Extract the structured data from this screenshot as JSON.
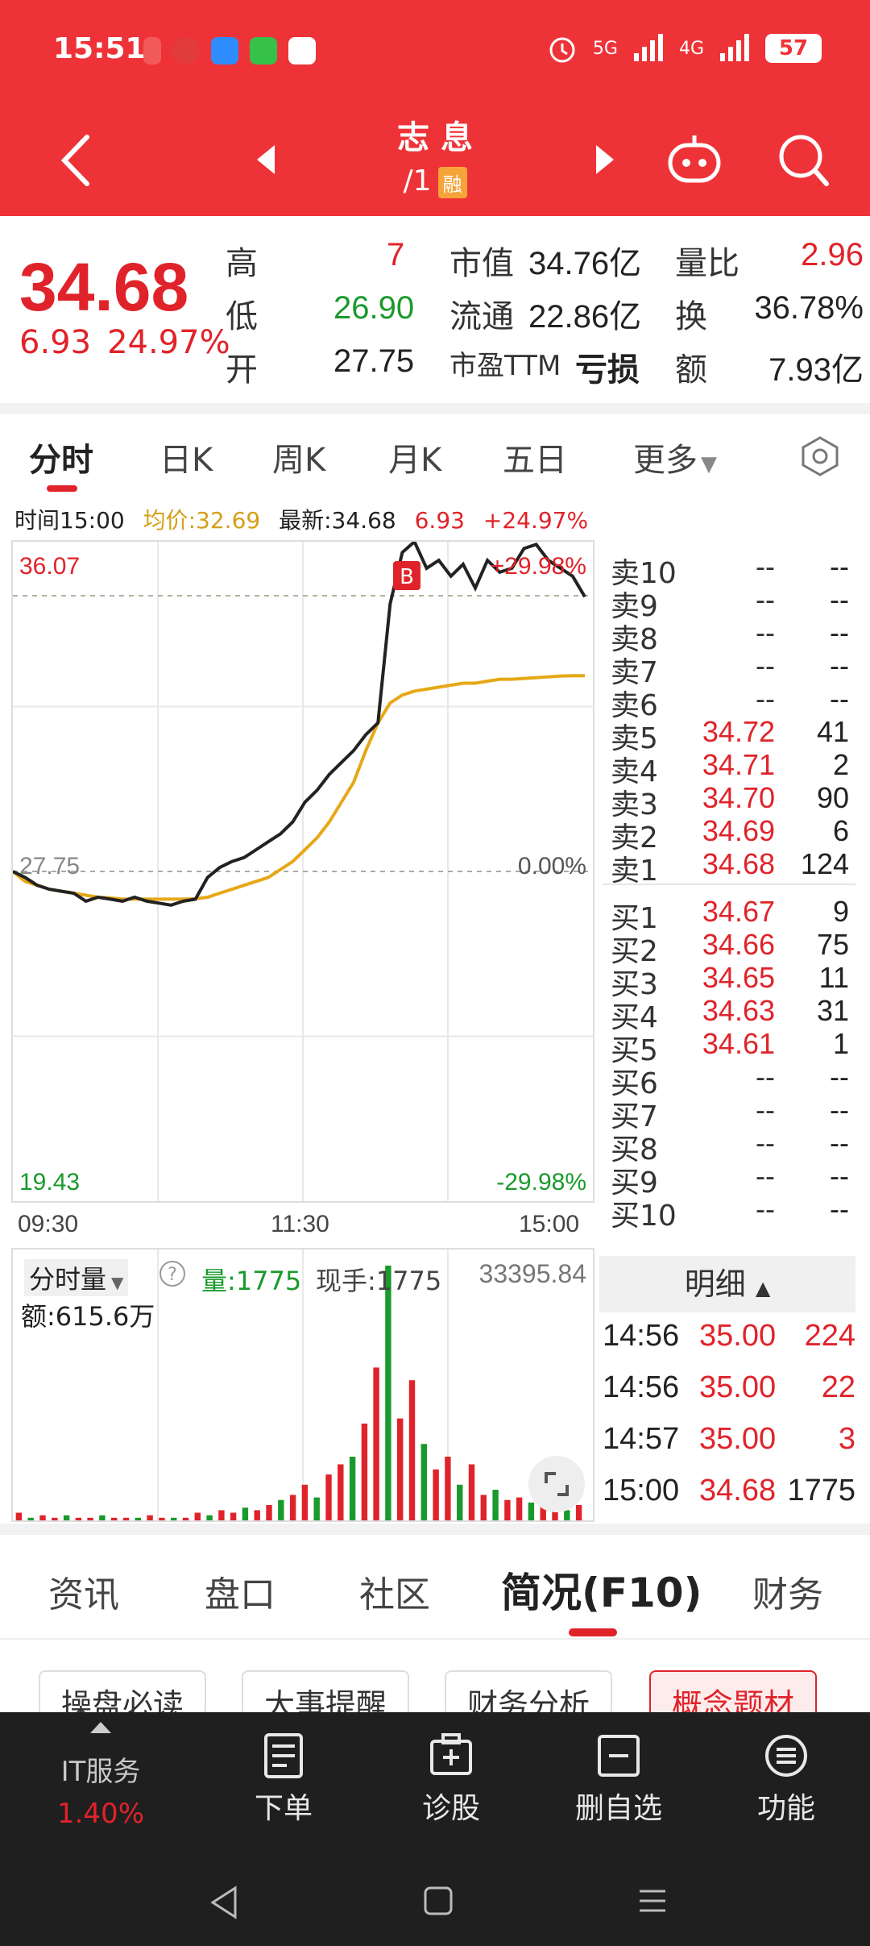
{
  "status_bar": {
    "time": "15:51",
    "battery": "57",
    "net1": "5G",
    "net2": "4G"
  },
  "nav": {
    "title": "志 息",
    "code": "/1",
    "badge": "融"
  },
  "quote": {
    "price": "34.68",
    "change": "6.93",
    "change_pct": "24.97%",
    "high_label": "高",
    "high_value": "7",
    "low_label": "低",
    "low_value": "26.90",
    "open_label": "开",
    "open_value": "27.75",
    "mcap_label": "市值",
    "mcap_value": "34.76亿",
    "float_label": "流通",
    "float_value": "22.86亿",
    "pe_label": "市盈TTM",
    "pe_value": "亏损",
    "vr_label": "量比",
    "vr_value": "2.96",
    "turnover_label": "换",
    "turnover_value": "36.78%",
    "amount_label": "额",
    "amount_value": "7.93亿"
  },
  "ktabs": [
    "分时",
    "日K",
    "周K",
    "月K",
    "五日",
    "更多"
  ],
  "info_line": {
    "time": "时间15:00",
    "avg": "均价:32.69",
    "latest": "最新:34.68",
    "chg": "6.93",
    "pct": "+24.97%"
  },
  "chart_data": {
    "type": "line",
    "y_top_label": "36.07",
    "y_top_pct": "+29.98%",
    "y_mid_label": "27.75",
    "y_mid_pct": "0.00%",
    "y_bottom_label": "19.43",
    "y_bottom_pct": "-29.98%",
    "ylim": [
      19.43,
      36.07
    ],
    "x_ticks": [
      "09:30",
      "11:30",
      "15:00"
    ],
    "marker": "B",
    "series": [
      {
        "values": [
          27.75,
          27.6,
          27.4,
          27.3,
          27.25,
          27.2,
          27.0,
          27.1,
          27.05,
          27.0,
          27.1,
          27.0,
          26.95,
          26.9,
          27.0,
          27.05,
          27.6,
          27.85,
          28.0,
          28.1,
          28.3,
          28.5,
          28.7,
          29.0,
          29.5,
          29.8,
          30.2,
          30.5,
          30.8,
          31.2,
          31.5,
          34.5,
          35.8,
          36.07,
          35.4,
          35.6,
          35.2,
          35.5,
          34.9,
          35.6,
          35.3,
          35.4,
          35.9,
          36.0,
          35.6,
          35.4,
          35.2,
          34.68
        ]
      },
      {
        "values": [
          27.75,
          27.5,
          27.4,
          27.3,
          27.25,
          27.2,
          27.15,
          27.1,
          27.08,
          27.05,
          27.05,
          27.05,
          27.05,
          27.05,
          27.05,
          27.06,
          27.1,
          27.2,
          27.3,
          27.4,
          27.5,
          27.6,
          27.8,
          28.0,
          28.3,
          28.6,
          29.0,
          29.5,
          30.0,
          30.8,
          31.5,
          32.0,
          32.2,
          32.3,
          32.35,
          32.4,
          32.45,
          32.5,
          32.5,
          32.55,
          32.6,
          32.6,
          32.62,
          32.64,
          32.66,
          32.68,
          32.69,
          32.69
        ]
      }
    ],
    "volume": {
      "label": "分时量",
      "qty": "量:1775",
      "cur": "现手:1775",
      "max": "33395.84",
      "amount": "额:615.6万",
      "values": [
        3,
        1,
        2,
        1,
        2,
        1,
        1,
        2,
        1,
        1,
        1,
        2,
        1,
        1,
        1,
        3,
        2,
        4,
        3,
        5,
        4,
        6,
        8,
        10,
        14,
        9,
        18,
        22,
        25,
        38,
        60,
        100,
        40,
        55,
        30,
        20,
        25,
        14,
        22,
        10,
        12,
        8,
        9,
        7,
        6,
        5,
        4,
        6
      ]
    }
  },
  "book": {
    "sell": [
      {
        "label": "卖10",
        "price": "--",
        "vol": "--"
      },
      {
        "label": "卖9",
        "price": "--",
        "vol": "--"
      },
      {
        "label": "卖8",
        "price": "--",
        "vol": "--"
      },
      {
        "label": "卖7",
        "price": "--",
        "vol": "--"
      },
      {
        "label": "卖6",
        "price": "--",
        "vol": "--"
      },
      {
        "label": "卖5",
        "price": "34.72",
        "vol": "41"
      },
      {
        "label": "卖4",
        "price": "34.71",
        "vol": "2"
      },
      {
        "label": "卖3",
        "price": "34.70",
        "vol": "90"
      },
      {
        "label": "卖2",
        "price": "34.69",
        "vol": "6"
      },
      {
        "label": "卖1",
        "price": "34.68",
        "vol": "124"
      }
    ],
    "buy": [
      {
        "label": "买1",
        "price": "34.67",
        "vol": "9"
      },
      {
        "label": "买2",
        "price": "34.66",
        "vol": "75"
      },
      {
        "label": "买3",
        "price": "34.65",
        "vol": "11"
      },
      {
        "label": "买4",
        "price": "34.63",
        "vol": "31"
      },
      {
        "label": "买5",
        "price": "34.61",
        "vol": "1"
      },
      {
        "label": "买6",
        "price": "--",
        "vol": "--"
      },
      {
        "label": "买7",
        "price": "--",
        "vol": "--"
      },
      {
        "label": "买8",
        "price": "--",
        "vol": "--"
      },
      {
        "label": "买9",
        "price": "--",
        "vol": "--"
      },
      {
        "label": "买10",
        "price": "--",
        "vol": "--"
      }
    ]
  },
  "detail": {
    "title": "明细",
    "rows": [
      {
        "time": "14:56",
        "price": "35.00",
        "vol": "224",
        "color": "#e0232a"
      },
      {
        "time": "14:56",
        "price": "35.00",
        "vol": "22",
        "color": "#e0232a"
      },
      {
        "time": "14:57",
        "price": "35.00",
        "vol": "3",
        "color": "#e0232a"
      },
      {
        "time": "15:00",
        "price": "34.68",
        "vol": "1775",
        "color": "#222222"
      }
    ]
  },
  "content_tabs": [
    "资讯",
    "盘口",
    "社区",
    "简况(F10)",
    "财务"
  ],
  "chips": [
    "操盘必读",
    "大事提醒",
    "财务分析",
    "概念题材"
  ],
  "bottom": {
    "sector_name": "IT服务",
    "sector_value": "1.40%",
    "items": [
      "下单",
      "诊股",
      "删自选",
      "功能"
    ]
  },
  "colors": {
    "red": "#e0232a",
    "green": "#1a9a2c",
    "header": "#ee3338",
    "avg_line": "#e6a817"
  }
}
